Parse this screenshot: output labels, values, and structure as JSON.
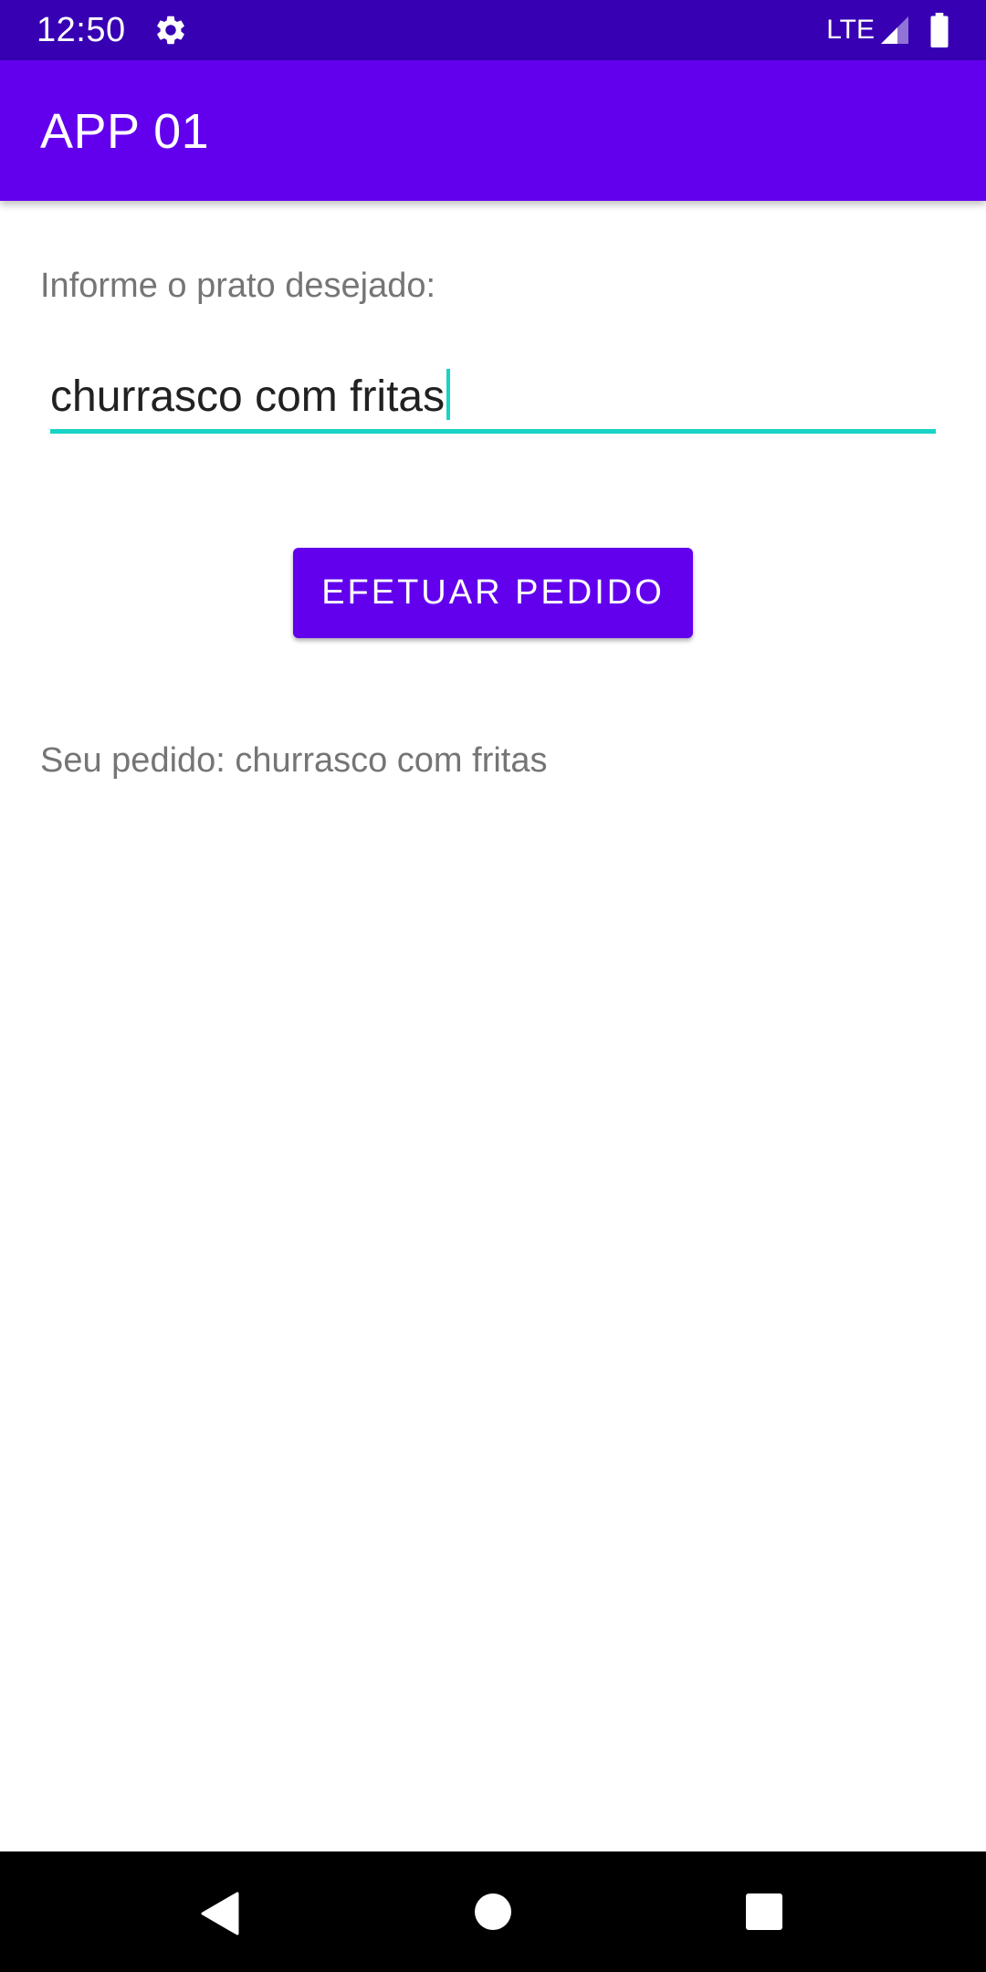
{
  "status_bar": {
    "time": "12:50",
    "network": "LTE",
    "icons": [
      "gear-icon",
      "signal-icon",
      "battery-icon"
    ],
    "background_color": "#3700b3"
  },
  "app_bar": {
    "title": "APP 01",
    "background_color": "#6200ee"
  },
  "form": {
    "prompt_label": "Informe o prato desejado:",
    "dish_input_value": "churrasco com fritas",
    "accent_color": "#19d3c5"
  },
  "order_button": {
    "label": "EFETUAR PEDIDO"
  },
  "result": {
    "text": "Seu pedido: churrasco com fritas"
  },
  "nav_bar": {
    "icons": [
      "back-icon",
      "home-icon",
      "recents-icon"
    ]
  }
}
